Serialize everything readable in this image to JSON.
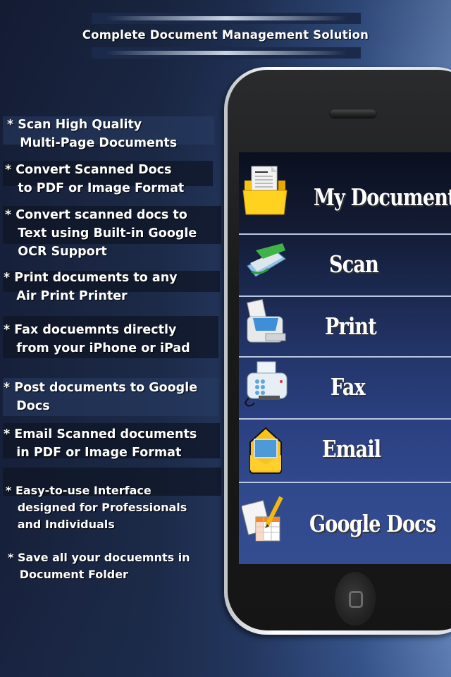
{
  "header": {
    "title": "Complete Document Management Solution"
  },
  "features": [
    "* Scan High Quality\n   Multi-Page Documents",
    "* Convert Scanned Docs\n   to PDF or Image Format",
    "* Convert scanned docs to\n   Text using Built-in Google\n   OCR Support",
    "* Print documents to any\n   Air Print Printer",
    "* Fax docuemnts directly\n   from your iPhone or iPad",
    "* Post documents to Google\n   Docs",
    "* Email Scanned documents\n   in PDF or Image Format",
    "* Easy-to-use Interface\n   designed for Professionals\n   and Individuals",
    "* Save all your docuemnts in\n   Document Folder"
  ],
  "menu": {
    "items": [
      {
        "label": "My Documents",
        "icon": "folder-document-icon"
      },
      {
        "label": "Scan",
        "icon": "scanner-icon"
      },
      {
        "label": "Print",
        "icon": "printer-icon"
      },
      {
        "label": "Fax",
        "icon": "fax-machine-icon"
      },
      {
        "label": "Email",
        "icon": "envelope-icon"
      },
      {
        "label": "Google Docs",
        "icon": "spreadsheet-pencil-icon"
      }
    ]
  },
  "colors": {
    "menu_gradient_top": "#0c1122",
    "menu_gradient_bottom": "#354f92",
    "divider": "#b9c6e2"
  }
}
